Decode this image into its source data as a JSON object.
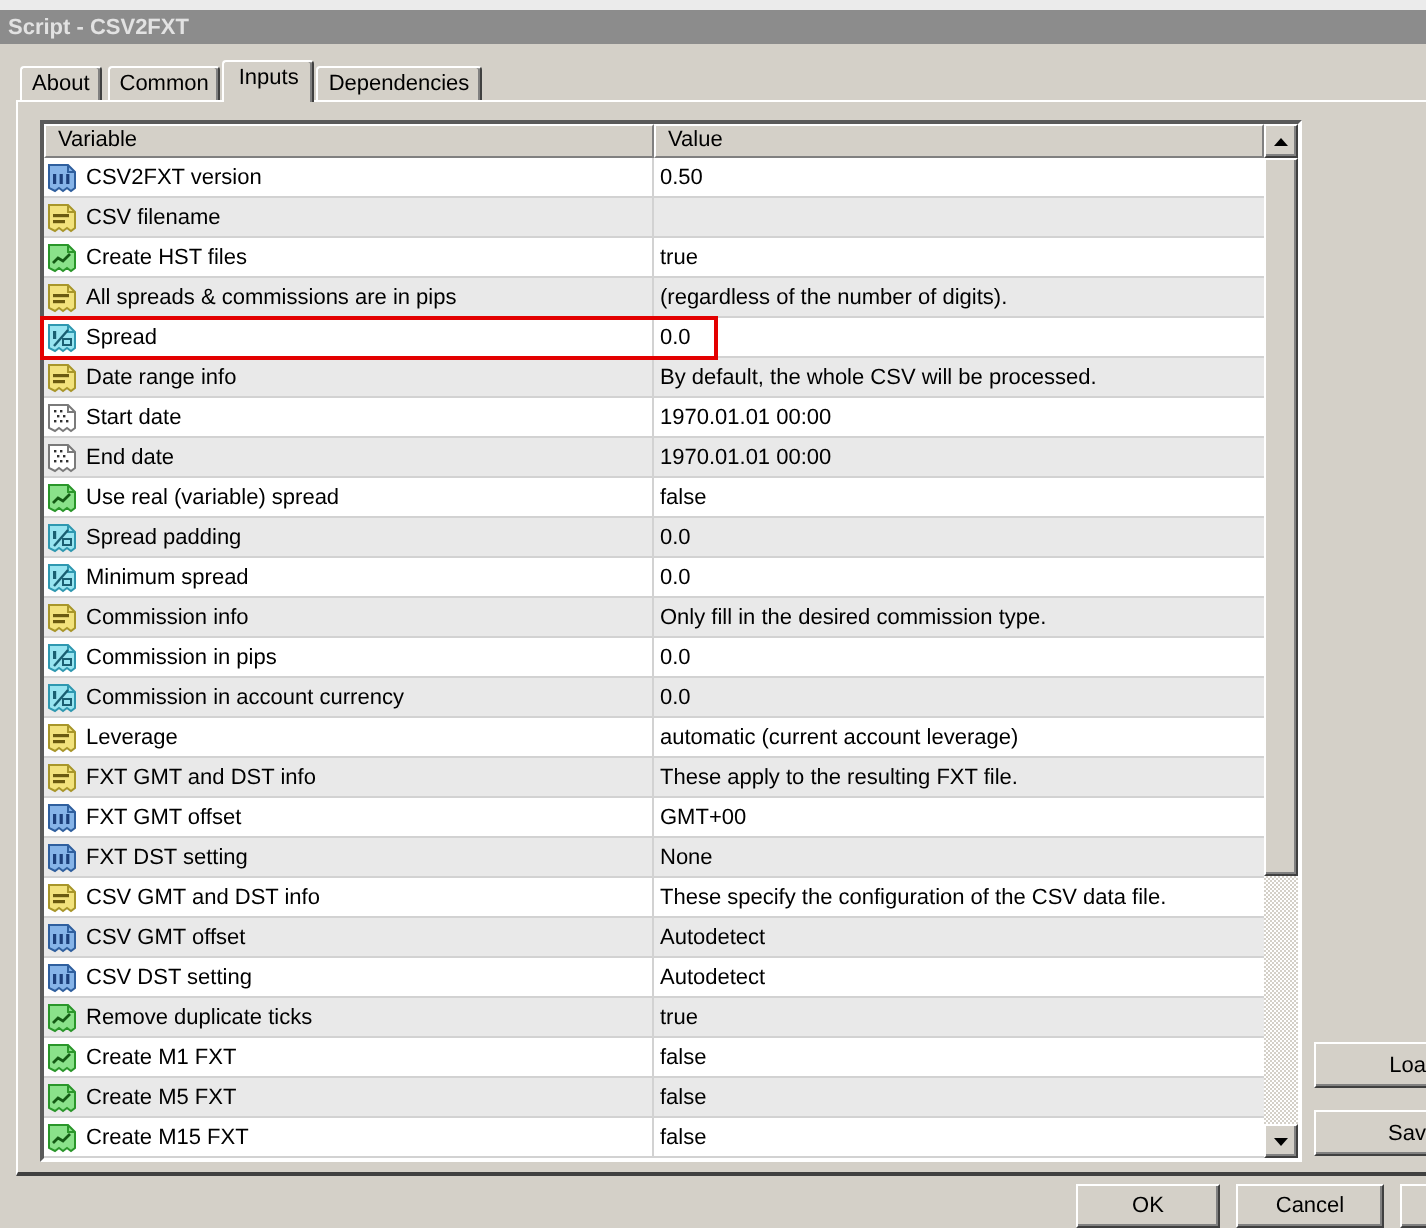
{
  "window": {
    "title": "Script - CSV2FXT"
  },
  "tabs": [
    {
      "label": "About",
      "selected": false
    },
    {
      "label": "Common",
      "selected": false
    },
    {
      "label": "Inputs",
      "selected": true
    },
    {
      "label": "Dependencies",
      "selected": false
    }
  ],
  "grid": {
    "columns": [
      "Variable",
      "Value"
    ],
    "rows": [
      {
        "kind": "int",
        "name": "CSV2FXT version",
        "value": "0.50",
        "highlighted": false
      },
      {
        "kind": "string",
        "name": "CSV filename",
        "highlighted": false
      },
      {
        "kind": "bool",
        "name": "Create HST files",
        "value": "true",
        "highlighted": false
      },
      {
        "kind": "string",
        "name": "All spreads & commissions are in pips",
        "value": "(regardless of the number of digits).",
        "highlighted": false
      },
      {
        "kind": "double",
        "name": "Spread",
        "value": "0.0",
        "highlighted": true
      },
      {
        "kind": "string",
        "name": "Date range info",
        "value": "By default, the whole CSV will be processed.",
        "highlighted": false
      },
      {
        "kind": "datetime",
        "name": "Start date",
        "value": "1970.01.01 00:00",
        "highlighted": false
      },
      {
        "kind": "datetime",
        "name": "End date",
        "value": "1970.01.01 00:00",
        "highlighted": false
      },
      {
        "kind": "bool",
        "name": "Use real (variable) spread",
        "value": "false",
        "highlighted": false
      },
      {
        "kind": "double",
        "name": "Spread padding",
        "value": "0.0",
        "highlighted": false
      },
      {
        "kind": "double",
        "name": "Minimum spread",
        "value": "0.0",
        "highlighted": false
      },
      {
        "kind": "string",
        "name": "Commission info",
        "value": "Only fill in the desired commission type.",
        "highlighted": false
      },
      {
        "kind": "double",
        "name": "Commission in pips",
        "value": "0.0",
        "highlighted": false
      },
      {
        "kind": "double",
        "name": "Commission in account currency",
        "value": "0.0",
        "highlighted": false
      },
      {
        "kind": "string",
        "name": "Leverage",
        "value": "automatic (current account leverage)",
        "highlighted": false
      },
      {
        "kind": "string",
        "name": "FXT GMT and DST info",
        "value": "These apply to the resulting FXT file.",
        "highlighted": false
      },
      {
        "kind": "int",
        "name": "FXT GMT offset",
        "value": "GMT+00",
        "highlighted": false
      },
      {
        "kind": "int",
        "name": "FXT DST setting",
        "value": "None",
        "highlighted": false
      },
      {
        "kind": "string",
        "name": "CSV GMT and DST info",
        "value": "These specify the configuration of the CSV data file.",
        "highlighted": false
      },
      {
        "kind": "int",
        "name": "CSV GMT offset",
        "value": "Autodetect",
        "highlighted": false
      },
      {
        "kind": "int",
        "name": "CSV DST setting",
        "value": "Autodetect",
        "highlighted": false
      },
      {
        "kind": "bool",
        "name": "Remove duplicate ticks",
        "value": "true",
        "highlighted": false
      },
      {
        "kind": "bool",
        "name": "Create M1 FXT",
        "value": "false",
        "highlighted": false
      },
      {
        "kind": "bool",
        "name": "Create M5 FXT",
        "value": "false",
        "highlighted": false
      },
      {
        "kind": "bool",
        "name": "Create M15 FXT",
        "value": "false",
        "highlighted": false
      }
    ]
  },
  "side_buttons": [
    "Loa",
    "Sav"
  ],
  "buttons": [
    "OK",
    "Cancel"
  ]
}
